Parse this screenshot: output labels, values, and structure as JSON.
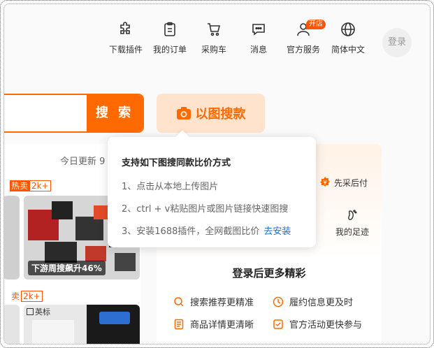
{
  "nav": {
    "items": [
      {
        "label": "下载插件",
        "icon": "puzzle-icon"
      },
      {
        "label": "我的订单",
        "icon": "order-clipboard-icon"
      },
      {
        "label": "采购车",
        "icon": "cart-icon"
      },
      {
        "label": "消息",
        "icon": "message-icon"
      },
      {
        "label": "官方服务",
        "icon": "service-user-icon",
        "badge": "开店"
      },
      {
        "label": "简体中文",
        "icon": "globe-icon"
      }
    ],
    "login": "登录"
  },
  "search": {
    "button": "搜 索",
    "image_search": "以图搜款"
  },
  "left": {
    "today_update": "今日更新 9",
    "hot_label_1": "热卖",
    "hot_count_1": "2k+",
    "product_caption": "下游周搜飙升46%",
    "hot_label_2": "卖",
    "hot_count_2": "2k+",
    "small_label": "英标"
  },
  "tooltip": {
    "title": "支持如下图搜同款比价方式",
    "line1": "1、点击从本地上传图片",
    "line2": "2、ctrl + v粘贴图片或图片链接快速图搜",
    "line3": "3、安装1688插件，全网截图比价",
    "install_link": "去安装"
  },
  "right": {
    "pay_later": "先采后付",
    "footprint": "我的足迹",
    "login_more": "登录后更多精彩",
    "benefits": [
      "搜索推荐更精准",
      "履约信息更及时",
      "商品详情更清晰",
      "官方活动更快参与"
    ]
  },
  "colors": {
    "accent": "#ff6a00",
    "link": "#1b6fd6"
  }
}
